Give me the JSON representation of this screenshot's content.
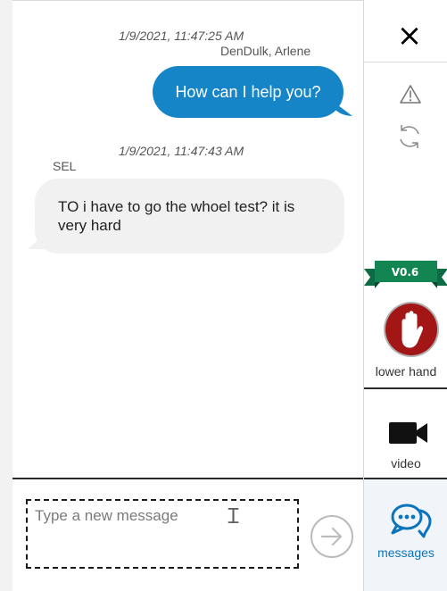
{
  "conversation": {
    "messages": [
      {
        "timestamp": "1/9/2021, 11:47:25 AM",
        "sender": "DenDulk, Arlene",
        "text": "How can I help you?",
        "direction": "outgoing"
      },
      {
        "timestamp": "1/9/2021, 11:47:43 AM",
        "sender": "SEL",
        "text": "TO i have to go the whoel test? it is very hard",
        "direction": "incoming"
      }
    ]
  },
  "composer": {
    "placeholder": "Type a new message",
    "send_icon": "arrow-right-icon"
  },
  "sidebar": {
    "close_icon": "close-icon",
    "warning_icon": "warning-icon",
    "refresh_icon": "refresh-icon",
    "version": "V0.6",
    "lower_hand": {
      "label": "lower hand",
      "icon": "hand-icon"
    },
    "video": {
      "label": "video",
      "icon": "video-camera-icon"
    },
    "messages": {
      "label": "messages",
      "icon": "chat-bubbles-icon"
    }
  },
  "colors": {
    "outgoing_bubble": "#1585c8",
    "incoming_bubble": "#f1f1f1",
    "hand_button": "#a31616",
    "ribbon": "#0b6b42",
    "messages_accent": "#0b74bd"
  }
}
